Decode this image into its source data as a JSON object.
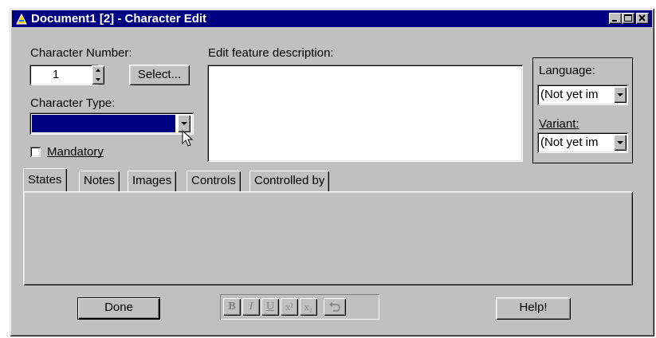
{
  "window": {
    "title": "Document1 [2] - Character Edit",
    "title_bg": "#000080",
    "face_color": "#c0c0c0",
    "minimize_icon": "minimize-icon",
    "maximize_icon": "maximize-icon",
    "close_icon": "close-icon"
  },
  "character_number": {
    "label": "Character Number:",
    "value": "1",
    "select_label": "Select..."
  },
  "character_type": {
    "label": "Character Type:",
    "value": "",
    "selected_color": "#000080"
  },
  "mandatory": {
    "label": "Mandatory",
    "checked": false
  },
  "feature_description": {
    "label": "Edit feature description:",
    "value": ""
  },
  "language": {
    "label": "Language:",
    "value": "(Not yet im"
  },
  "variant": {
    "label": "Variant:",
    "value": "(Not yet im"
  },
  "tabs": [
    {
      "label": "States",
      "active": true
    },
    {
      "label": "Notes",
      "active": false
    },
    {
      "label": "Images",
      "active": false
    },
    {
      "label": "Controls",
      "active": false
    },
    {
      "label": "Controlled by",
      "active": false
    }
  ],
  "format_toolbar": {
    "bold": "B",
    "italic": "I",
    "underline": "U",
    "superscript": "x²",
    "subscript": "x₂",
    "undo_icon": "undo-icon"
  },
  "buttons": {
    "done": "Done",
    "help": "Help!"
  }
}
